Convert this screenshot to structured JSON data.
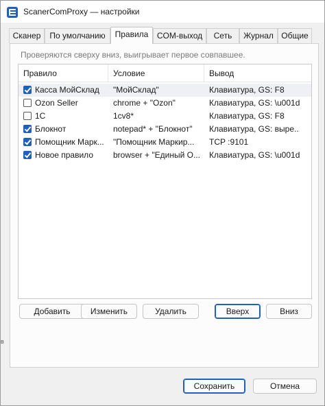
{
  "window": {
    "title": "ScanerComProxy — настройки"
  },
  "tabs": [
    {
      "label": "Сканер"
    },
    {
      "label": "По умолчанию"
    },
    {
      "label": "Правила"
    },
    {
      "label": "COM-выход"
    },
    {
      "label": "Сеть"
    },
    {
      "label": "Журнал"
    },
    {
      "label": "Общие"
    }
  ],
  "active_tab": "Правила",
  "rules_panel": {
    "hint": "Проверяются сверху вниз, выигрывает первое совпавшее.",
    "columns": [
      "Правило",
      "Условие",
      "Вывод"
    ],
    "rows": [
      {
        "checked": true,
        "rule": "Касса МойСклад",
        "condition": "\"МойСклад\"",
        "output": "Клавиатура, GS: F8"
      },
      {
        "checked": false,
        "rule": "Ozon Seller",
        "condition": "chrome + \"Ozon\"",
        "output": "Клавиатура, GS: \\u001d"
      },
      {
        "checked": false,
        "rule": "1С",
        "condition": "1cv8*",
        "output": "Клавиатура, GS: F8"
      },
      {
        "checked": true,
        "rule": "Блокнот",
        "condition": "notepad* + \"Блокнот\"",
        "output": "Клавиатура, GS: выре..."
      },
      {
        "checked": true,
        "rule": "Помощник Марк...",
        "condition": "\"Помощник Маркир...",
        "output": "TCP :9101"
      },
      {
        "checked": true,
        "rule": "Новое правило",
        "condition": "browser + \"Единый О...",
        "output": "Клавиатура, GS: \\u001d"
      }
    ],
    "buttons": {
      "add": "Добавить",
      "edit": "Изменить",
      "delete": "Удалить",
      "up": "Вверх",
      "down": "Вниз"
    }
  },
  "footer": {
    "save": "Сохранить",
    "cancel": "Отмена"
  },
  "left_edge_mark": "в"
}
